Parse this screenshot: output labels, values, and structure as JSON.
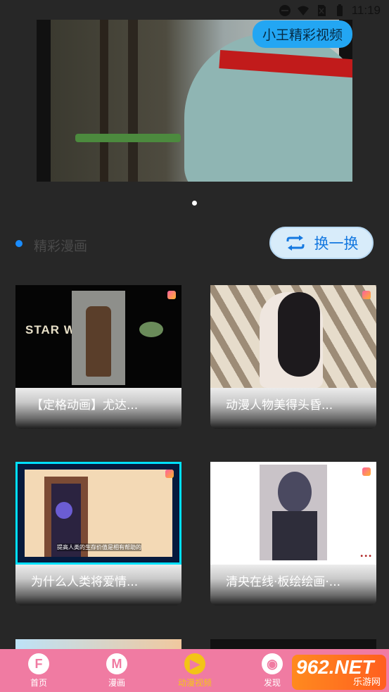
{
  "status_bar": {
    "time": "11:19",
    "icons": [
      "minus-circle-icon",
      "wifi-icon",
      "no-sim-icon",
      "battery-icon"
    ]
  },
  "banner": {
    "badge": "小王精彩视频",
    "pager": {
      "count": 1,
      "active": 1
    }
  },
  "section": {
    "title": "精彩漫画",
    "refresh_label": "换一换",
    "refresh_icon": "repeat-icon"
  },
  "cards": [
    {
      "title": "【定格动画】尤达...",
      "thumb_text": "STAR WARS"
    },
    {
      "title": "动漫人物美得头昏..."
    },
    {
      "title": "为什么人类将爱情...",
      "thumb_text": "提高人类的生存价值是相有帮助的"
    },
    {
      "title": "清央在线·板绘绘画·...",
      "thumb_text": "•••"
    }
  ],
  "tabbar": {
    "items": [
      {
        "label": "首页",
        "icon": "F",
        "icon_name": "home-icon"
      },
      {
        "label": "漫画",
        "icon": "M",
        "icon_name": "comic-icon"
      },
      {
        "label": "动漫视频",
        "icon": "▶",
        "icon_name": "play-icon",
        "active": true
      },
      {
        "label": "发现",
        "icon": "◉",
        "icon_name": "eye-icon"
      }
    ],
    "active_color": "#f5c518",
    "bar_color": "#f07ba2"
  },
  "watermark": {
    "big": "962.NET",
    "small": "乐游网"
  }
}
